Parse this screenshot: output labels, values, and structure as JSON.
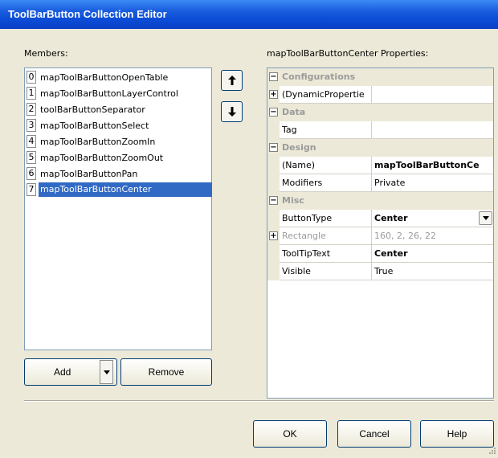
{
  "window": {
    "title": "ToolBarButton Collection Editor"
  },
  "members": {
    "label": "Members:",
    "items": [
      {
        "index": "0",
        "name": "mapToolBarButtonOpenTable",
        "selected": false
      },
      {
        "index": "1",
        "name": "mapToolBarButtonLayerControl",
        "selected": false
      },
      {
        "index": "2",
        "name": "toolBarButtonSeparator",
        "selected": false
      },
      {
        "index": "3",
        "name": "mapToolBarButtonSelect",
        "selected": false
      },
      {
        "index": "4",
        "name": "mapToolBarButtonZoomIn",
        "selected": false
      },
      {
        "index": "5",
        "name": "mapToolBarButtonZoomOut",
        "selected": false
      },
      {
        "index": "6",
        "name": "mapToolBarButtonPan",
        "selected": false
      },
      {
        "index": "7",
        "name": "mapToolBarButtonCenter",
        "selected": true
      }
    ],
    "move_up_icon": "arrow-up-icon",
    "move_down_icon": "arrow-down-icon"
  },
  "properties": {
    "label": "mapToolBarButtonCenter Properties:",
    "categories": {
      "configurations": "Configurations",
      "data": "Data",
      "design": "Design",
      "misc": "Misc"
    },
    "rows": {
      "dynamic": {
        "name": "(DynamicPropertie",
        "value": ""
      },
      "tag": {
        "name": "Tag",
        "value": ""
      },
      "name": {
        "name": "(Name)",
        "value": "mapToolBarButtonCe"
      },
      "modifiers": {
        "name": "Modifiers",
        "value": "Private"
      },
      "buttontype": {
        "name": "ButtonType",
        "value": "Center"
      },
      "rectangle": {
        "name": "Rectangle",
        "value": "160, 2, 26, 22"
      },
      "tooltip": {
        "name": "ToolTipText",
        "value": "Center"
      },
      "visible": {
        "name": "Visible",
        "value": "True"
      }
    }
  },
  "buttons": {
    "add": "Add",
    "remove": "Remove",
    "ok": "OK",
    "cancel": "Cancel",
    "help": "Help"
  },
  "colors": {
    "title_bar": "#0b4bd6",
    "selection": "#316ac5",
    "dialog_bg": "#ece9d8"
  }
}
